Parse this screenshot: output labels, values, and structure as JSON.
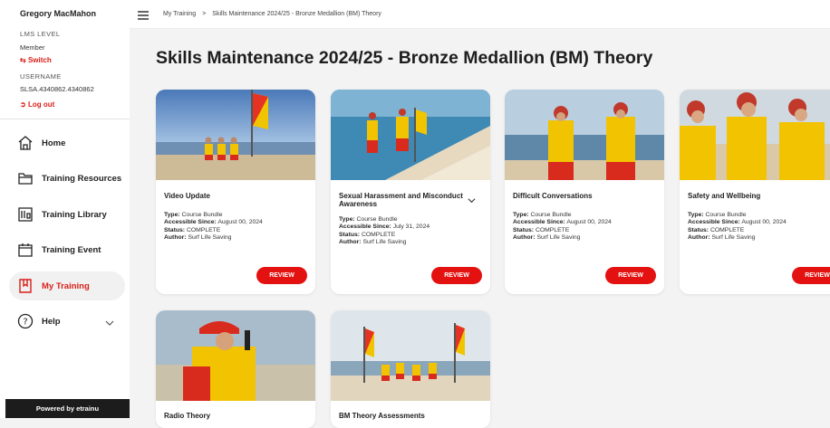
{
  "user": {
    "name": "Gregory MacMahon",
    "lms_level_label": "LMS LEVEL",
    "level": "Member",
    "switch_label": "Switch",
    "username_label": "USERNAME",
    "username": "SLSA.4340862.4340862",
    "logout_label": "Log out"
  },
  "nav": {
    "items": [
      {
        "label": "Home",
        "icon": "home-icon"
      },
      {
        "label": "Training Resources",
        "icon": "folder-icon"
      },
      {
        "label": "Training Library",
        "icon": "library-icon"
      },
      {
        "label": "Training Event",
        "icon": "calendar-icon"
      },
      {
        "label": "My Training",
        "icon": "bookmark-icon",
        "active": true
      },
      {
        "label": "Help",
        "icon": "help-icon"
      }
    ]
  },
  "footer": {
    "powered": "Powered by etrainu"
  },
  "breadcrumb": {
    "root": "My Training",
    "separator": ">",
    "current": "Skills Maintenance 2024/25 - Bronze Medallion (BM) Theory"
  },
  "page": {
    "title": "Skills Maintenance 2024/25 - Bronze Medallion (BM) Theory"
  },
  "meta_labels": {
    "type": "Type:",
    "since": "Accessible Since:",
    "status": "Status:",
    "author": "Author:"
  },
  "cards": [
    {
      "title": "Video Update",
      "type": "Course Bundle",
      "since": "August 00, 2024",
      "status": "COMPLETE",
      "author": "Surf Life Saving",
      "button": "REVIEW"
    },
    {
      "title": "Sexual Harassment and Misconduct Awareness",
      "type": "Course Bundle",
      "since": "July 31, 2024",
      "status": "COMPLETE",
      "author": "Surf Life Saving",
      "button": "REVIEW"
    },
    {
      "title": "Difficult Conversations",
      "type": "Course Bundle",
      "since": "August 00, 2024",
      "status": "COMPLETE",
      "author": "Surf Life Saving",
      "button": "REVIEW"
    },
    {
      "title": "Safety and Wellbeing",
      "type": "Course Bundle",
      "since": "August 00, 2024",
      "status": "COMPLETE",
      "author": "Surf Life Saving",
      "button": "REVIEW"
    },
    {
      "title": "Radio Theory"
    },
    {
      "title": "BM Theory Assessments"
    }
  ],
  "colors": {
    "accent": "#d91e18",
    "button": "#e3110f",
    "footer": "#1c1c1c"
  }
}
